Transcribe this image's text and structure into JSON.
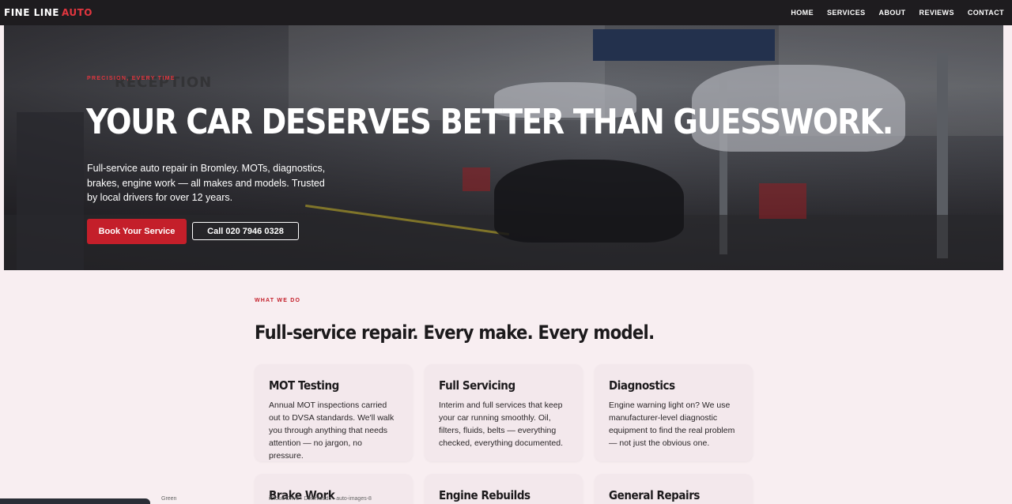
{
  "brand": {
    "name": "FINE LINE",
    "accent": "AUTO",
    "accent_color": "#e2363f"
  },
  "nav": {
    "items": [
      {
        "label": "HOME"
      },
      {
        "label": "SERVICES"
      },
      {
        "label": "ABOUT"
      },
      {
        "label": "REVIEWS"
      },
      {
        "label": "CONTACT"
      }
    ]
  },
  "hero": {
    "eyebrow": "PRECISION, EVERY TIME",
    "headline": "YOUR CAR DESERVES BETTER THAN GUESSWORK.",
    "subtitle": "Full-service auto repair in Bromley. MOTs, diagnostics, brakes, engine work — all makes and models. Trusted by local drivers for over 12 years.",
    "primary_cta": "Book Your Service",
    "secondary_cta": "Call 020 7946 0328",
    "background_sign": "RECEPTION"
  },
  "services": {
    "eyebrow": "WHAT WE DO",
    "title": "Full-service repair. Every make. Every model.",
    "cards": [
      {
        "title": "MOT Testing",
        "text": "Annual MOT inspections carried out to DVSA standards. We'll walk you through anything that needs attention — no jargon, no pressure."
      },
      {
        "title": "Full Servicing",
        "text": "Interim and full services that keep your car running smoothly. Oil, filters, fluids, belts — everything checked, everything documented."
      },
      {
        "title": "Diagnostics",
        "text": "Engine warning light on? We use manufacturer-level diagnostic equipment to find the real problem — not just the obvious one."
      },
      {
        "title": "Brake Work",
        "text": ""
      },
      {
        "title": "Engine Rebuilds",
        "text": ""
      },
      {
        "title": "General Repairs",
        "text": ""
      }
    ]
  },
  "colors": {
    "accent": "#c41f2a",
    "nav_bg": "#1e1c1f",
    "page_bg": "#f8eef1",
    "card_bg": "#f3e8ec"
  },
  "footer_strip": {
    "left_text": "Green",
    "path_text": "iCloud Drive › Downloads › auto-images-8"
  }
}
